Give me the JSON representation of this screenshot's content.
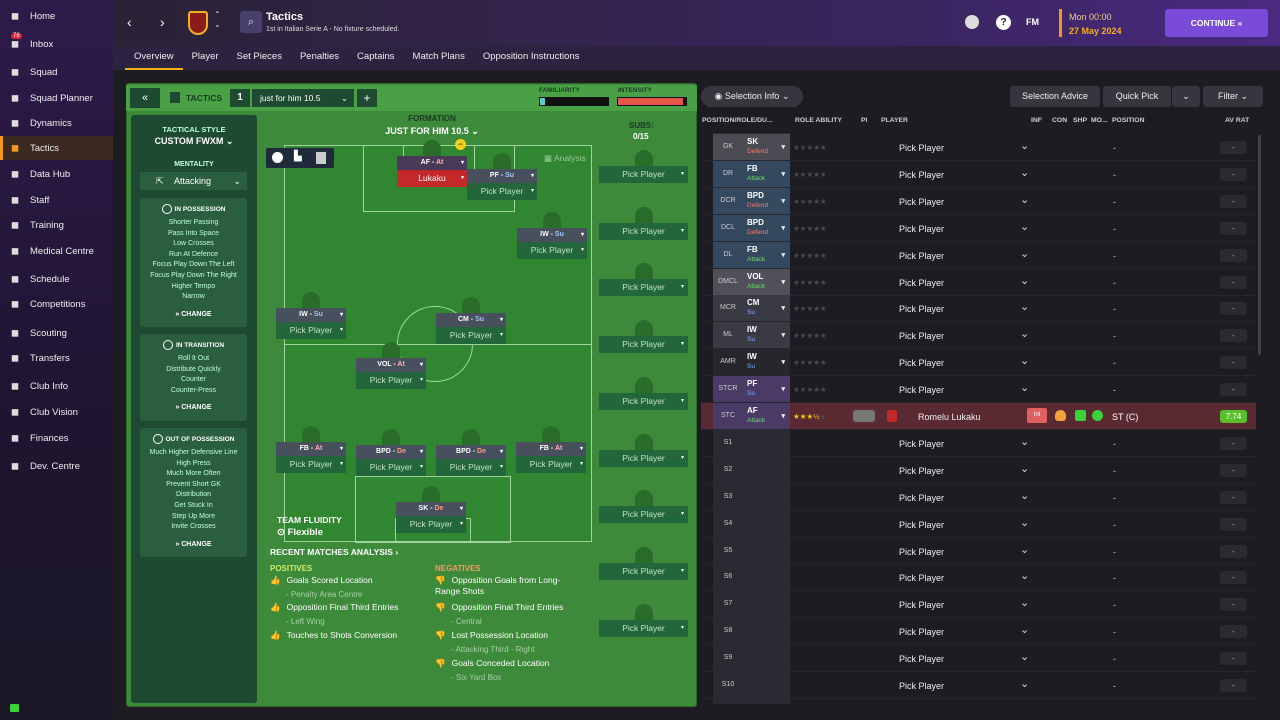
{
  "sidebar": {
    "items": [
      {
        "label": "Home",
        "icon": "home-icon"
      },
      {
        "label": "Inbox",
        "icon": "inbox-icon",
        "badge": "76"
      },
      {
        "label": "Squad",
        "icon": "squad-icon"
      },
      {
        "label": "Squad Planner",
        "icon": "planner-icon"
      },
      {
        "label": "Dynamics",
        "icon": "dynamics-icon"
      },
      {
        "label": "Tactics",
        "icon": "tactics-icon",
        "active": true
      },
      {
        "label": "Data Hub",
        "icon": "datahub-icon"
      },
      {
        "label": "Staff",
        "icon": "staff-icon"
      },
      {
        "label": "Training",
        "icon": "training-icon"
      },
      {
        "label": "Medical Centre",
        "icon": "medical-icon"
      },
      {
        "label": "Schedule",
        "icon": "schedule-icon"
      },
      {
        "label": "Competitions",
        "icon": "trophy-icon"
      },
      {
        "label": "Scouting",
        "icon": "scouting-icon"
      },
      {
        "label": "Transfers",
        "icon": "transfers-icon"
      },
      {
        "label": "Club Info",
        "icon": "shield-icon"
      },
      {
        "label": "Club Vision",
        "icon": "vision-icon"
      },
      {
        "label": "Finances",
        "icon": "finances-icon"
      },
      {
        "label": "Dev. Centre",
        "icon": "dev-icon"
      }
    ]
  },
  "topbar": {
    "title": "Tactics",
    "subtitle": "1st in Italian Serie A - No fixture scheduled.",
    "day": "Mon 00:00",
    "date": "27 May 2024",
    "fm": "FM",
    "continue": "CONTINUE"
  },
  "tabs": [
    "Overview",
    "Player",
    "Set Pieces",
    "Penalties",
    "Captains",
    "Match Plans",
    "Opposition Instructions"
  ],
  "tactics_bar": {
    "label": "TACTICS",
    "slot": "1",
    "name": "just for him 10.5",
    "familiarity": "FAMILIARITY",
    "intensity": "INTENSITY",
    "familiarity_value": 0.08,
    "intensity_value": 0.95
  },
  "style": {
    "title": "TACTICAL STYLE",
    "name": "CUSTOM FWXM",
    "mentality_label": "MENTALITY",
    "mentality": "Attacking"
  },
  "possession": {
    "title": "IN POSSESSION",
    "items": [
      "Shorter Passing",
      "Pass Into Space",
      "Low Crosses",
      "Run At Defence",
      "Focus Play Down The Left",
      "Focus Play Down The Right",
      "Higher Tempo",
      "Narrow"
    ],
    "change": "CHANGE"
  },
  "transition": {
    "title": "IN TRANSITION",
    "items": [
      "Roll It Out",
      "Distribute Quickly",
      "Counter",
      "Counter-Press"
    ],
    "change": "CHANGE"
  },
  "oop": {
    "title": "OUT OF POSSESSION",
    "items": [
      "Much Higher Defensive Line",
      "High Press",
      "Much More Often",
      "Prevent Short GK",
      "Distribution",
      "Get Stuck In",
      "Step Up More",
      "Invite Crosses"
    ],
    "change": "CHANGE"
  },
  "formation": {
    "label": "FORMATION",
    "name": "JUST FOR HIM 10.5",
    "analysis": "Analysis",
    "subs_label": "SUBS:",
    "subs": "0/15",
    "fluidity_label": "TEAM FLUIDITY",
    "fluidity": "Flexible"
  },
  "pitch_players": [
    {
      "role": "AF",
      "duty": "At",
      "name": "Lukaku",
      "filled": true
    },
    {
      "role": "PF",
      "duty": "Su",
      "name": "Pick Player"
    },
    {
      "role": "IW",
      "duty": "Su",
      "name": "Pick Player"
    },
    {
      "role": "IW",
      "duty": "Su",
      "name": "Pick Player"
    },
    {
      "role": "CM",
      "duty": "Su",
      "name": "Pick Player"
    },
    {
      "role": "VOL",
      "duty": "At",
      "name": "Pick Player"
    },
    {
      "role": "FB",
      "duty": "At",
      "name": "Pick Player"
    },
    {
      "role": "BPD",
      "duty": "De",
      "name": "Pick Player"
    },
    {
      "role": "BPD",
      "duty": "De",
      "name": "Pick Player"
    },
    {
      "role": "FB",
      "duty": "At",
      "name": "Pick Player"
    },
    {
      "role": "SK",
      "duty": "De",
      "name": "Pick Player"
    }
  ],
  "subs_pick": "Pick Player",
  "analysis": {
    "title": "RECENT MATCHES ANALYSIS",
    "positives_label": "POSITIVES",
    "negatives_label": "NEGATIVES",
    "positives": [
      {
        "t": "Goals Scored Location",
        "s": "- Penalty Area Centre"
      },
      {
        "t": "Opposition Final Third Entries",
        "s": "- Left Wing"
      },
      {
        "t": "Touches to Shots Conversion",
        "s": ""
      }
    ],
    "negatives": [
      {
        "t": "Opposition Goals from Long-Range Shots",
        "s": ""
      },
      {
        "t": "Opposition Final Third Entries",
        "s": "- Central"
      },
      {
        "t": "Lost Possession Location",
        "s": "- Attacking Third - Right"
      },
      {
        "t": "Goals Conceded Location",
        "s": "- Six Yard Box"
      }
    ]
  },
  "right": {
    "selection_info": "Selection Info",
    "selection_advice": "Selection Advice",
    "quick_pick": "Quick Pick",
    "filter": "Filter",
    "headers": [
      "POSITION/ROLE/DU...",
      "ROLE ABILITY",
      "PI",
      "PLAYER",
      "INF",
      "CON",
      "SHP",
      "MO...",
      "POSITION",
      "AV RAT"
    ]
  },
  "rows": [
    {
      "pos": "GK",
      "role": "SK",
      "duty": "Defend",
      "player": "Pick Player",
      "dash": "-",
      "av": "-",
      "c": "#4b4b54"
    },
    {
      "pos": "DR",
      "role": "FB",
      "duty": "Attack",
      "player": "Pick Player",
      "dash": "-",
      "av": "-",
      "c": "#34485e"
    },
    {
      "pos": "DCR",
      "role": "BPD",
      "duty": "Defend",
      "player": "Pick Player",
      "dash": "-",
      "av": "-",
      "c": "#34485e"
    },
    {
      "pos": "DCL",
      "role": "BPD",
      "duty": "Defend",
      "player": "Pick Player",
      "dash": "-",
      "av": "-",
      "c": "#34485e"
    },
    {
      "pos": "DL",
      "role": "FB",
      "duty": "Attack",
      "player": "Pick Player",
      "dash": "-",
      "av": "-",
      "c": "#34485e"
    },
    {
      "pos": "DMCL",
      "role": "VOL",
      "duty": "Attack",
      "player": "Pick Player",
      "dash": "-",
      "av": "-",
      "c": "#50505a"
    },
    {
      "pos": "MCR",
      "role": "CM",
      "duty": "Su",
      "player": "Pick Player",
      "dash": "-",
      "av": "-",
      "c": "#3a3a44"
    },
    {
      "pos": "ML",
      "role": "IW",
      "duty": "Su",
      "player": "Pick Player",
      "dash": "-",
      "av": "-",
      "c": "#3a3a44"
    },
    {
      "pos": "AMR",
      "role": "IW",
      "duty": "Su",
      "player": "Pick Player",
      "dash": "-",
      "av": "-",
      "c": "#26262c"
    },
    {
      "pos": "STCR",
      "role": "PF",
      "duty": "Su",
      "player": "Pick Player",
      "dash": "-",
      "av": "-",
      "c": "#4a3a66"
    },
    {
      "pos": "STC",
      "role": "AF",
      "duty": "Attack",
      "player": "Romelu Lukaku",
      "dash": "ST (C)",
      "av": "7.74",
      "c": "#4a3a66",
      "filled": true,
      "inf": "Int"
    },
    {
      "pos": "S1",
      "player": "Pick Player",
      "dash": "-",
      "av": "-"
    },
    {
      "pos": "S2",
      "player": "Pick Player",
      "dash": "-",
      "av": "-"
    },
    {
      "pos": "S3",
      "player": "Pick Player",
      "dash": "-",
      "av": "-"
    },
    {
      "pos": "S4",
      "player": "Pick Player",
      "dash": "-",
      "av": "-"
    },
    {
      "pos": "S5",
      "player": "Pick Player",
      "dash": "-",
      "av": "-"
    },
    {
      "pos": "S6",
      "player": "Pick Player",
      "dash": "-",
      "av": "-"
    },
    {
      "pos": "S7",
      "player": "Pick Player",
      "dash": "-",
      "av": "-"
    },
    {
      "pos": "S8",
      "player": "Pick Player",
      "dash": "-",
      "av": "-"
    },
    {
      "pos": "S9",
      "player": "Pick Player",
      "dash": "-",
      "av": "-"
    },
    {
      "pos": "S10",
      "player": "Pick Player",
      "dash": "-",
      "av": "-"
    }
  ]
}
